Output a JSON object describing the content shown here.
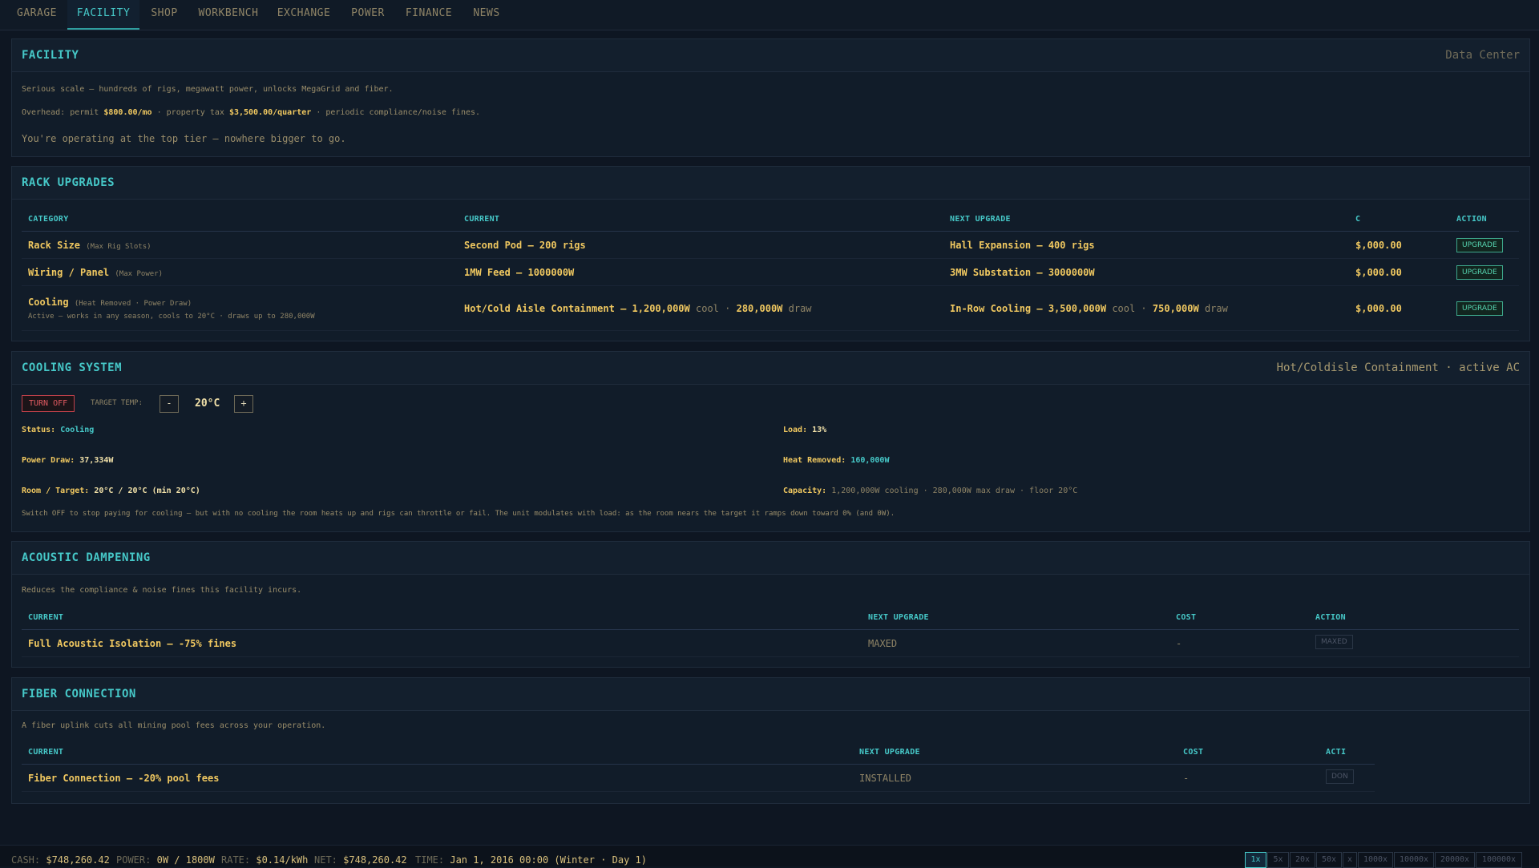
{
  "tabs": [
    "GARAGE",
    "FACILITY",
    "SHOP",
    "WORKBENCH",
    "EXCHANGE",
    "POWER",
    "FINANCE",
    "NEWS"
  ],
  "facility": {
    "title": "FACILITY",
    "tier": "Data Center",
    "description": "Serious scale — hundreds of rigs, megawatt power, unlocks MegaGrid and fiber.",
    "overhead_prefix": "Overhead: permit",
    "permit": "$800.00/mo",
    "tax_prefix": "· property tax",
    "tax": "$3,500.00/quarter",
    "overhead_suffix": "· periodic compliance/noise fines.",
    "top_tier_note": "You're operating at the top tier — nowhere bigger to go."
  },
  "rack": {
    "title": "RACK UPGRADES",
    "headers": [
      "CATEGORY",
      "CURRENT",
      "NEXT UPGRADE",
      "C",
      "ACTION"
    ],
    "rows": [
      {
        "category": "Rack Size",
        "sub": "(Max Rig Slots)",
        "current": "Second Pod — 200 rigs",
        "next": "Hall Expansion — 400 rigs",
        "cost": "$,000.00",
        "action": "UPGRADE"
      },
      {
        "category": "Wiring / Panel",
        "sub": "(Max Power)",
        "current": "1MW Feed — 1000000W",
        "next": "3MW Substation — 3000000W",
        "cost": "$,000.00",
        "action": "UPGRADE"
      },
      {
        "category": "Cooling",
        "sub": "(Heat Removed · Power Draw)",
        "note": "Active — works in any season, cools to 20°C · draws up to 280,000W",
        "current": "Hot/Cold Aisle Containment — 1,200,000W",
        "current_cool": "cool ·",
        "current_draw": "280,000W",
        "current_draw_lbl": "draw",
        "next": "In-Row Cooling — 3,500,000W",
        "next_cool": "cool ·",
        "next_draw": "750,000W",
        "next_draw_lbl": "draw",
        "cost": "$,000.00",
        "action": "UPGRADE"
      }
    ]
  },
  "cooling": {
    "title": "COOLING SYSTEM",
    "right": "Hot/Coldisle Containment · active AC",
    "toggle": "TURN OFF",
    "target_label": "TARGET TEMP:",
    "minus": "-",
    "plus": "+",
    "temp": "20°C",
    "status_label": "Status:",
    "status": "Cooling",
    "load_label": "Load:",
    "load": "13%",
    "power_label": "Power Draw:",
    "power": "37,334W",
    "heat_label": "Heat Removed:",
    "heat": "160,000W",
    "room_label": "Room / Target:",
    "room": "20°C / 20°C (min 20°C)",
    "capacity_label": "Capacity:",
    "capacity": "1,200,000W cooling · 280,000W max draw · floor 20°C",
    "note": "Switch OFF to stop paying for cooling — but with no cooling the room heats up and rigs can throttle or fail. The unit modulates with load: as the room nears the target it ramps down toward 0% (and 0W)."
  },
  "acoustic": {
    "title": "ACOUSTIC DAMPENING",
    "description": "Reduces the compliance & noise fines this facility incurs.",
    "headers": [
      "CURRENT",
      "NEXT UPGRADE",
      "COST",
      "ACTION"
    ],
    "current": "Full Acoustic Isolation — -75% fines",
    "next": "MAXED",
    "cost": "-",
    "action": "MAXED"
  },
  "fiber": {
    "title": "FIBER CONNECTION",
    "description": "A fiber uplink cuts all mining pool fees across your operation.",
    "headers": [
      "CURRENT",
      "NEXT UPGRADE",
      "COST",
      "ACTI"
    ],
    "current": "Fiber Connection — -20% pool fees",
    "next": "INSTALLED",
    "cost": "-",
    "action": "DON"
  },
  "footer": {
    "cash_label": "CASH:",
    "cash": "$748,260.42",
    "power_label": "POWER:",
    "power": "0W / 1800W",
    "rate_label": "RATE:",
    "rate": "$0.14/kWh",
    "net_label": "NET:",
    "net": "$748,260.42",
    "time_label": "TIME:",
    "time": "Jan 1, 2016 00:00 (Winter · Day 1)",
    "speeds": [
      "1x",
      "5x",
      "20x",
      "50x",
      "x",
      "1000x",
      "10000x",
      "20000x",
      "100000x"
    ]
  }
}
